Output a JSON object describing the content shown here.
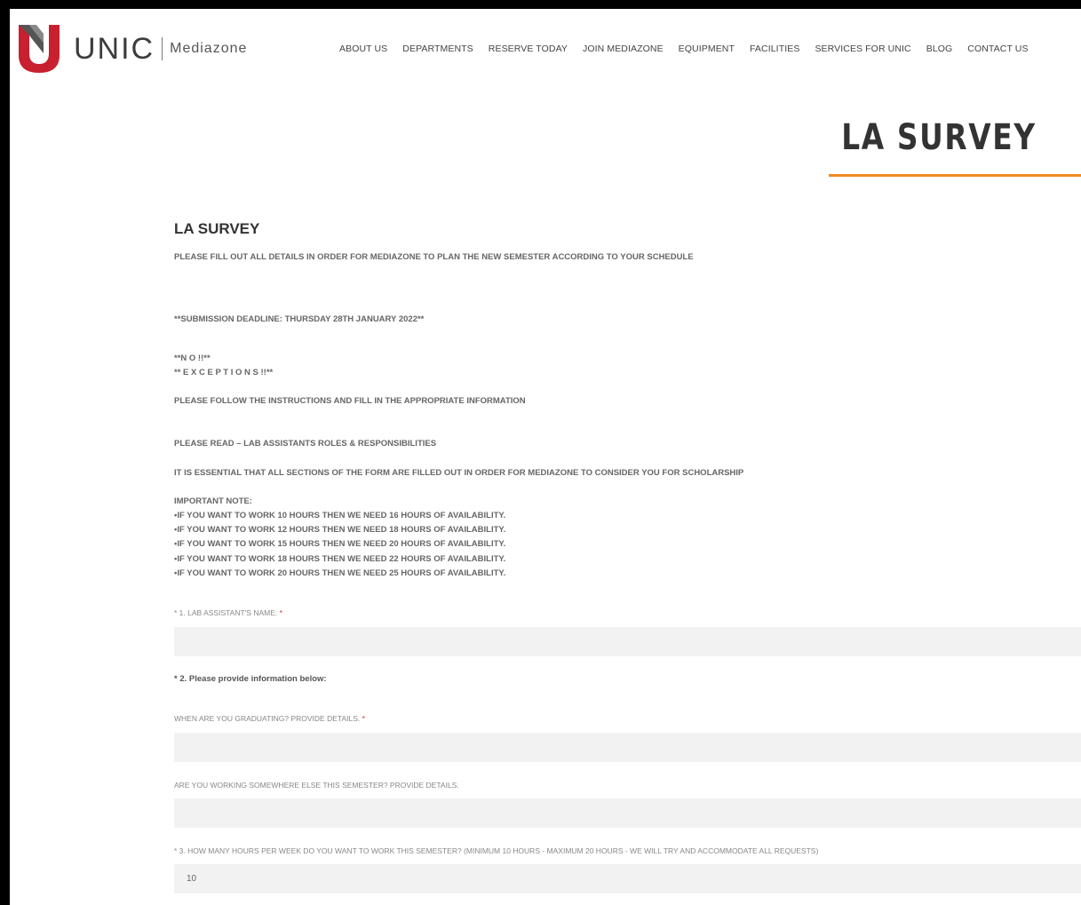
{
  "header": {
    "logo_text": "UNIC",
    "logo_sub": "Mediazone",
    "nav": [
      "ABOUT US",
      "DEPARTMENTS",
      "RESERVE TODAY",
      "JOIN MEDIAZONE",
      "EQUIPMENT",
      "FACILITIES",
      "SERVICES FOR UNIC",
      "BLOG",
      "CONTACT US"
    ]
  },
  "page_title": "LA SURVEY",
  "colors": {
    "accent_orange": "#f08a24",
    "logo_red": "#c8202f",
    "required": "#d32f2f"
  },
  "form": {
    "heading": "LA SURVEY",
    "intro": "PLEASE FILL OUT ALL DETAILS IN ORDER FOR MEDIAZONE TO PLAN THE NEW SEMESTER ACCORDING TO YOUR SCHEDULE",
    "deadline": "**SUBMISSION DEADLINE: THURSDAY 28TH JANUARY 2022**",
    "no_line": "**N O !!**",
    "exceptions_line": "** E X C E P T I O N S !!**",
    "follow": "PLEASE FOLLOW THE INSTRUCTIONS AND FILL IN THE APPROPRIATE INFORMATION",
    "read": "PLEASE READ – LAB ASSISTANTS ROLES & RESPONSIBILITIES",
    "essential": "IT IS ESSENTIAL THAT ALL SECTIONS OF THE FORM ARE FILLED OUT IN ORDER FOR MEDIAZONE TO CONSIDER YOU FOR SCHOLARSHIP",
    "note_title": "IMPORTANT NOTE:",
    "notes": [
      "•IF YOU WANT TO WORK 10 HOURS THEN WE NEED 16 HOURS OF AVAILABILITY.",
      "•IF YOU WANT TO WORK 12 HOURS THEN WE NEED 18 HOURS OF AVAILABILITY.",
      "•IF YOU WANT TO WORK 15 HOURS THEN WE NEED 20 HOURS OF AVAILABILITY.",
      "•IF YOU WANT TO WORK 18 HOURS THEN WE NEED 22 HOURS OF AVAILABILITY.",
      "•IF YOU WANT TO WORK 20 HOURS THEN WE NEED 25 HOURS OF AVAILABILITY."
    ],
    "q1_label": "* 1. LAB ASSISTANT'S NAME:",
    "q1_value": "",
    "q2_label": "* 2. Please provide information below:",
    "q2a_label": "WHEN ARE YOU GRADUATING? PROVIDE DETAILS.",
    "q2a_value": "",
    "q2b_label": "ARE YOU WORKING SOMEWHERE ELSE THIS SEMESTER? PROVIDE DETAILS.",
    "q2b_value": "",
    "q3_label": "* 3. HOW MANY HOURS PER WEEK DO YOU WANT TO WORK THIS SEMESTER? (MINIMUM 10 HOURS - MAXIMUM 20 HOURS - WE WILL TRY AND ACCOMMODATE ALL REQUESTS)",
    "q3_value": "10",
    "required_mark": "*"
  }
}
